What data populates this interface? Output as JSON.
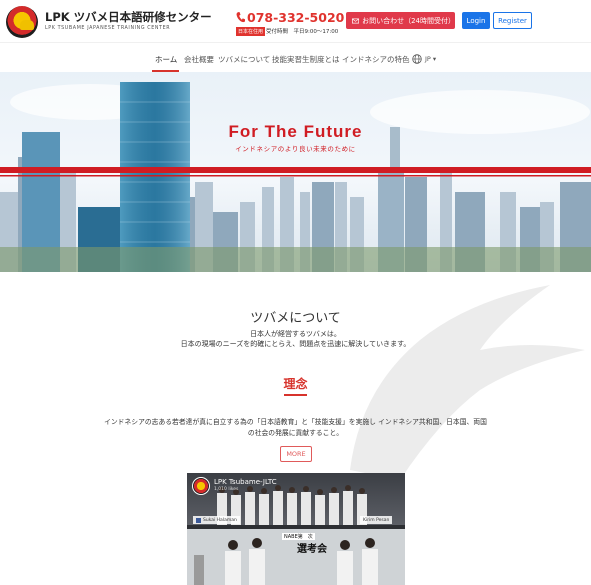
{
  "header": {
    "site_title": "LPK ツバメ日本語研修センター",
    "site_subtitle": "LPK TSUBAME JAPANESE TRAINING CENTER",
    "phone": "078-332-5020",
    "hours_badge": "日本在住用",
    "hours": "受付時間　平日9:00〜17:00",
    "contact_label": "お問い合わせ（24時間受付）",
    "login_label": "Login",
    "register_label": "Register"
  },
  "nav": {
    "items": [
      "ホーム",
      "会社概要",
      "ツバメについて",
      "技能実習生制度とは",
      "インドネシアの特色"
    ],
    "active_index": 0,
    "lang": "JP"
  },
  "hero": {
    "title": "For The Future",
    "subtitle": "インドネシアのより良い未来のために"
  },
  "about": {
    "title": "ツバメについて",
    "line1": "日本人が経営するツバメは。",
    "line2": "日本の現場のニーズを的確にとらえ、問題点を迅速に解決していきます。"
  },
  "philosophy": {
    "title": "理念",
    "line1": "インドネシアの志ある若者達が真に自立する為の「日本語教育」と「技能支援」を実施し インドネシア共和国、日本国、両国",
    "line2": "の社会の発展に貢献すること。",
    "more_label": "MORE"
  },
  "facebook": {
    "page_name": "LPK Tsubame-JLTC",
    "likes": "1,010 likes",
    "tag_left": "Sukai Halaman",
    "tag_right": "Kirim Pesan",
    "banner_small": "NABE第　次",
    "banner_large": "選考会"
  },
  "colors": {
    "brand_red": "#d7332c",
    "primary_blue": "#1a74e8"
  }
}
